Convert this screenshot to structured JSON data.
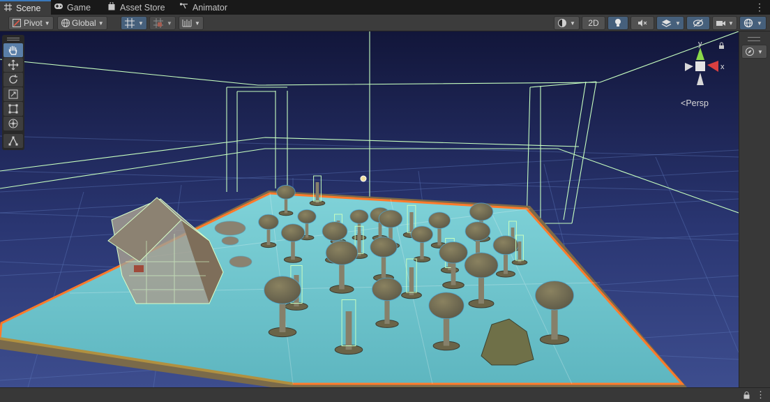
{
  "tabs": [
    {
      "label": "Scene",
      "icon": "grid-icon"
    },
    {
      "label": "Game",
      "icon": "gamepad-icon"
    },
    {
      "label": "Asset Store",
      "icon": "shopping-bag-icon"
    },
    {
      "label": "Animator",
      "icon": "animator-icon"
    }
  ],
  "toolbar": {
    "pivot_label": "Pivot",
    "global_label": "Global",
    "mode_2d_label": "2D"
  },
  "tools": [
    "hand-tool",
    "move-tool",
    "rotate-tool",
    "scale-tool",
    "rect-tool",
    "transform-tool",
    "custom-tool"
  ],
  "gizmo": {
    "y_label": "y",
    "x_label": "x",
    "projection_label": "Persp"
  },
  "colors": {
    "accent": "#3a79bb",
    "sky_top": "#14183a",
    "sky_horizon": "#3a4a88",
    "ground_plane": "#70c4cc",
    "selection_outline": "#ff7a2a",
    "wireframe": "#b8ffb0",
    "axis_x": "#d94040",
    "axis_y": "#8ad84a"
  }
}
